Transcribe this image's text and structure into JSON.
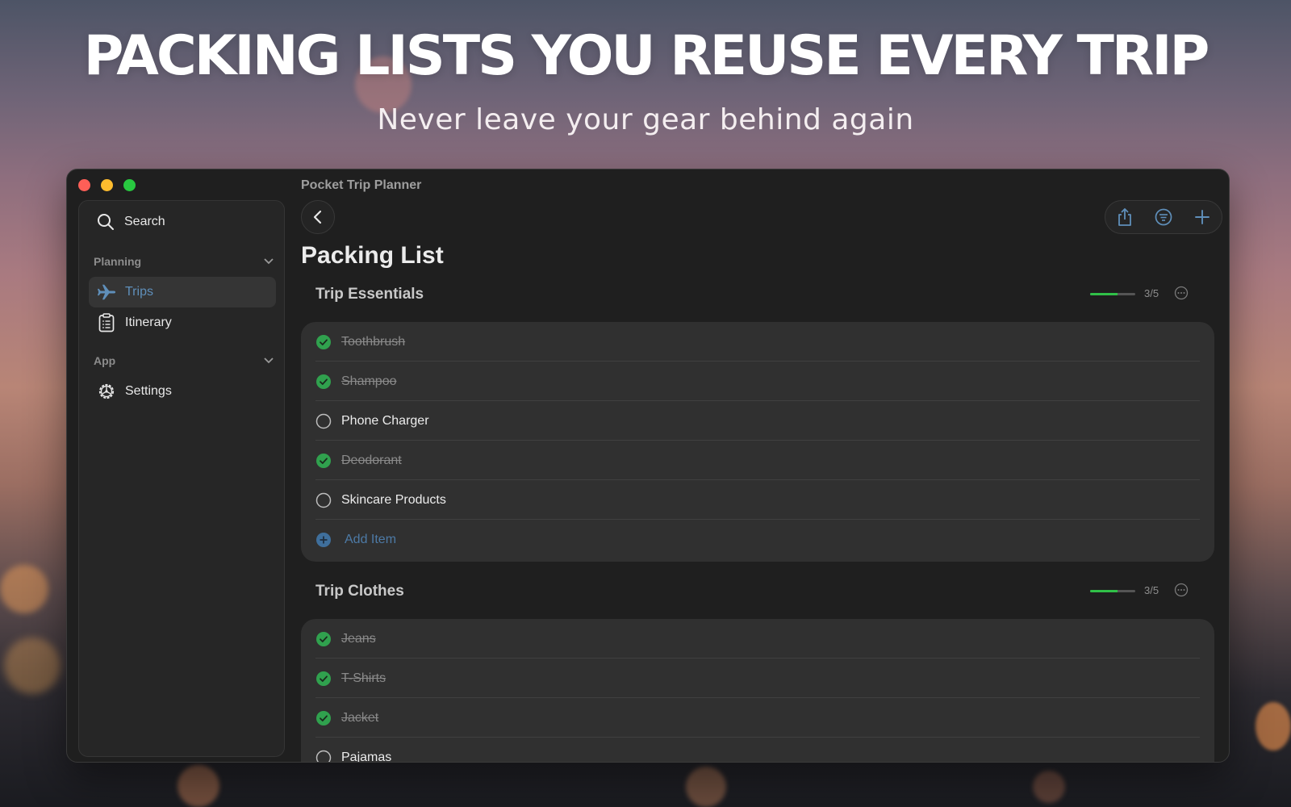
{
  "hero": {
    "title": "PACKING LISTS YOU REUSE EVERY TRIP",
    "subtitle": "Never leave your gear behind again"
  },
  "window": {
    "title": "Pocket Trip Planner"
  },
  "sidebar": {
    "search_label": "Search",
    "sections": [
      {
        "label": "Planning",
        "items": [
          {
            "label": "Trips",
            "icon": "airplane-icon",
            "active": true
          },
          {
            "label": "Itinerary",
            "icon": "clipboard-icon",
            "active": false
          }
        ]
      },
      {
        "label": "App",
        "items": [
          {
            "label": "Settings",
            "icon": "gear-icon",
            "active": false
          }
        ]
      }
    ]
  },
  "toolbar": {
    "icons": [
      "share-icon",
      "filter-icon",
      "plus-icon"
    ]
  },
  "page": {
    "title": "Packing List"
  },
  "lists": [
    {
      "title": "Trip Essentials",
      "count": "3/5",
      "progress": 0.6,
      "items": [
        {
          "label": "Toothbrush",
          "done": true
        },
        {
          "label": "Shampoo",
          "done": true
        },
        {
          "label": "Phone Charger",
          "done": false
        },
        {
          "label": "Deodorant",
          "done": true
        },
        {
          "label": "Skincare Products",
          "done": false
        }
      ],
      "add_label": "Add Item"
    },
    {
      "title": "Trip Clothes",
      "count": "3/5",
      "progress": 0.6,
      "items": [
        {
          "label": "Jeans",
          "done": true
        },
        {
          "label": "T-Shirts",
          "done": true
        },
        {
          "label": "Jacket",
          "done": true
        },
        {
          "label": "Pajamas",
          "done": false
        }
      ]
    }
  ],
  "colors": {
    "accent": "#5f8fba",
    "check_green": "#30a14e",
    "progress_green": "#30c048",
    "window_bg": "#1f1f1f",
    "card_bg": "#303030"
  }
}
